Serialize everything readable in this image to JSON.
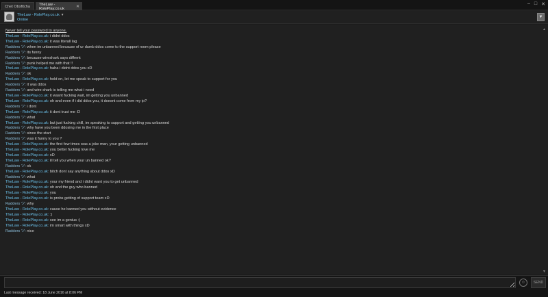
{
  "tabs": [
    {
      "label": "Chet Obsfitcha"
    },
    {
      "label": "TheLaw - RolePlay.co.uk"
    }
  ],
  "window_controls": [
    "–",
    "□",
    "✕"
  ],
  "header": {
    "name": "TheLaw - RolePlay.co.uk",
    "status": "Online"
  },
  "warning": "Never tell your password to anyone.",
  "messages": [
    {
      "author": "TheLaw - RolePlay.co.uk:",
      "text": "i didnt ddos",
      "who": "me"
    },
    {
      "author": "TheLaw - RolePlay.co.uk:",
      "text": "it was literall lag",
      "who": "me"
    },
    {
      "author": "Radders ツ:",
      "text": "when im unbanned because of ur dumb ddos come to the support room please",
      "who": "them"
    },
    {
      "author": "Radders ツ:",
      "text": "its funny",
      "who": "them"
    },
    {
      "author": "Radders ツ:",
      "text": "because wireshark says diffrent",
      "who": "them"
    },
    {
      "author": "Radders ツ:",
      "text": "punk helped me with that !!",
      "who": "them"
    },
    {
      "author": "TheLaw - RolePlay.co.uk:",
      "text": "haha i didnt ddos you xD",
      "who": "me"
    },
    {
      "author": "Radders ツ:",
      "text": "ok",
      "who": "them"
    },
    {
      "author": "TheLaw - RolePlay.co.uk:",
      "text": "hold on, let me speak to support for you",
      "who": "me"
    },
    {
      "author": "Radders ツ:",
      "text": "it was ddos",
      "who": "them"
    },
    {
      "author": "Radders ツ:",
      "text": "and wire shark is telling me what i need",
      "who": "them"
    },
    {
      "author": "TheLaw - RolePlay.co.uk:",
      "text": "it wasnt fucking wait, im getting you unbanned",
      "who": "me"
    },
    {
      "author": "TheLaw - RolePlay.co.uk:",
      "text": "oh and even if i did ddos you, it doesnt come from my ip?",
      "who": "me"
    },
    {
      "author": "Radders ツ:",
      "text": "i dont",
      "who": "them"
    },
    {
      "author": "TheLaw - RolePlay.co.uk:",
      "text": "it dont trust me :D",
      "who": "me"
    },
    {
      "author": "Radders ツ:",
      "text": "what",
      "who": "them"
    },
    {
      "author": "TheLaw - RolePlay.co.uk:",
      "text": "but just fucking chill, im speaking to support and getting you unbanned",
      "who": "me"
    },
    {
      "author": "Radders ツ:",
      "text": "why have you been ddosing me in the first place",
      "who": "them"
    },
    {
      "author": "Radders ツ:",
      "text": "since the start",
      "who": "them"
    },
    {
      "author": "Radders ツ:",
      "text": "was it funny to you ?",
      "who": "them"
    },
    {
      "author": "TheLaw - RolePlay.co.uk:",
      "text": "the first few times was a joke man, your getting unbanned",
      "who": "me"
    },
    {
      "author": "TheLaw - RolePlay.co.uk:",
      "text": "you better fucking love me",
      "who": "me"
    },
    {
      "author": "TheLaw - RolePlay.co.uk:",
      "text": "xD",
      "who": "me"
    },
    {
      "author": "TheLaw - RolePlay.co.uk:",
      "text": "ill tell you when your un banned ok?",
      "who": "me"
    },
    {
      "author": "Radders ツ:",
      "text": "ok",
      "who": "them"
    },
    {
      "author": "TheLaw - RolePlay.co.uk:",
      "text": "bitch dont say anything about ddos xD",
      "who": "me"
    },
    {
      "author": "Radders ツ:",
      "text": "what",
      "who": "them"
    },
    {
      "author": "TheLaw - RolePlay.co.uk:",
      "text": "your my friend and i didnt want you to get unbanned",
      "who": "me"
    },
    {
      "author": "TheLaw - RolePlay.co.uk:",
      "text": "oh and the guy who banned",
      "who": "me"
    },
    {
      "author": "TheLaw - RolePlay.co.uk:",
      "text": "you",
      "who": "me"
    },
    {
      "author": "TheLaw - RolePlay.co.uk:",
      "text": "is probs getting of support team xD",
      "who": "me"
    },
    {
      "author": "Radders ツ:",
      "text": "why",
      "who": "them"
    },
    {
      "author": "TheLaw - RolePlay.co.uk:",
      "text": "cause he banned you without evidence",
      "who": "me"
    },
    {
      "author": "TheLaw - RolePlay.co.uk:",
      "text": ":)",
      "who": "me"
    },
    {
      "author": "TheLaw - RolePlay.co.uk:",
      "text": "see im a genius :)",
      "who": "me"
    },
    {
      "author": "TheLaw - RolePlay.co.uk:",
      "text": "im smart with things xD",
      "who": "me"
    },
    {
      "author": "Radders ツ:",
      "text": "nice",
      "who": "them"
    }
  ],
  "input": {
    "value": "",
    "placeholder": ""
  },
  "send_label": "SEND",
  "footer": "Last message received: 18 June 2016 at 8:06 PM",
  "colors": {
    "author": "#6cc2ec",
    "background": "#202020"
  }
}
